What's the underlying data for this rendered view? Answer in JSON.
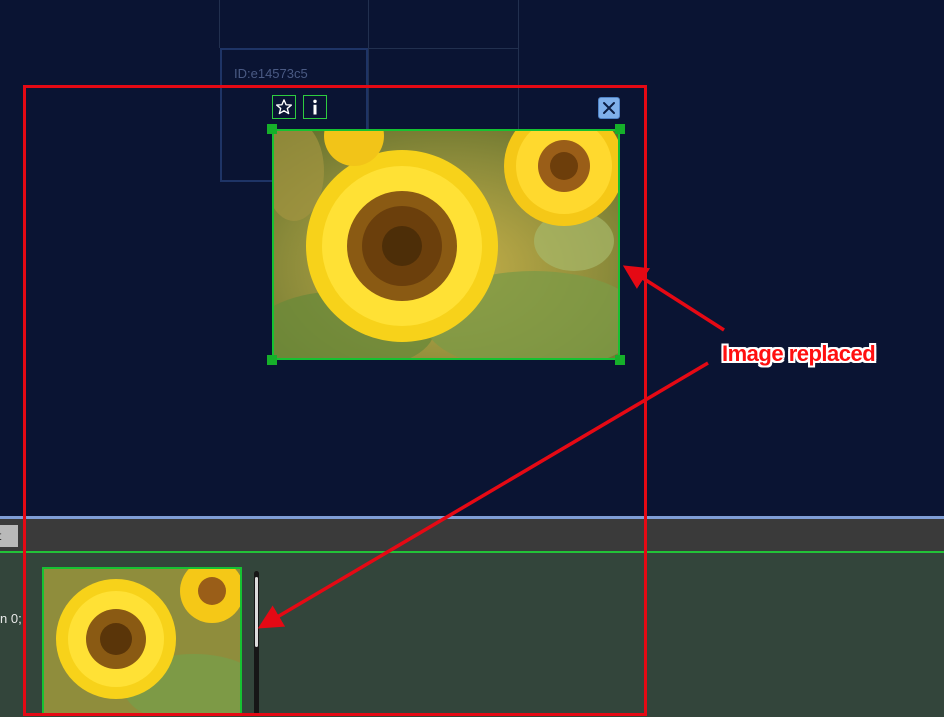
{
  "canvas": {
    "cell_id_label": "ID:e14573c5"
  },
  "element_toolbar": {
    "favorite_icon": "star-icon",
    "info_icon": "info-icon",
    "close_icon": "close-icon"
  },
  "image": {
    "subject": "sunflowers"
  },
  "timeline": {
    "tab_label": "t",
    "partial_text": "n 0;"
  },
  "annotation": {
    "label": "Image replaced",
    "color": "#e50914"
  },
  "colors": {
    "canvas_bg": "#0a1433",
    "selection_green": "#16c232",
    "timeline_bg": "#33453b",
    "divider": "#7f9ed6"
  }
}
